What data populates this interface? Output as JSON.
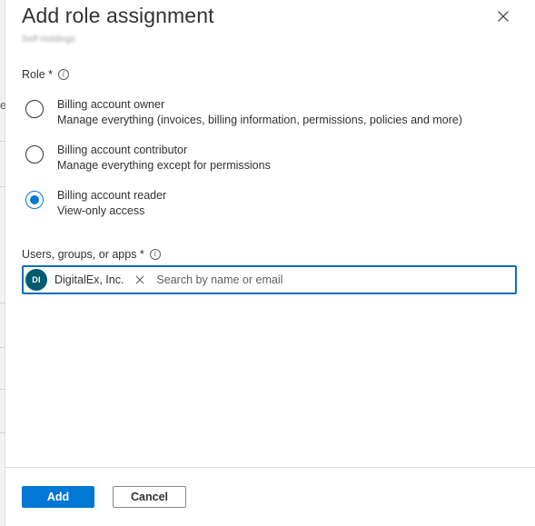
{
  "panel": {
    "title": "Add role assignment",
    "subtitle": "Self Holdings"
  },
  "role": {
    "label": "Role *",
    "options": [
      {
        "title": "Billing account owner",
        "description": "Manage everything (invoices, billing information, permissions, policies and more)",
        "selected": false
      },
      {
        "title": "Billing account contributor",
        "description": "Manage everything except for permissions",
        "selected": false
      },
      {
        "title": "Billing account reader",
        "description": "View-only access",
        "selected": true
      }
    ]
  },
  "users": {
    "label": "Users, groups, or apps *",
    "selected": [
      {
        "initials": "DI",
        "name": "DigitalEx, Inc.",
        "avatar_color": "#005b70"
      }
    ],
    "placeholder": "Search by name or email"
  },
  "footer": {
    "add_label": "Add",
    "cancel_label": "Cancel"
  },
  "backdrop": {
    "fragment_text": "e"
  },
  "colors": {
    "accent": "#0078d4",
    "focus_border": "#0f6cbd"
  },
  "icons": [
    "close-icon",
    "info-icon",
    "chip-remove-icon"
  ]
}
